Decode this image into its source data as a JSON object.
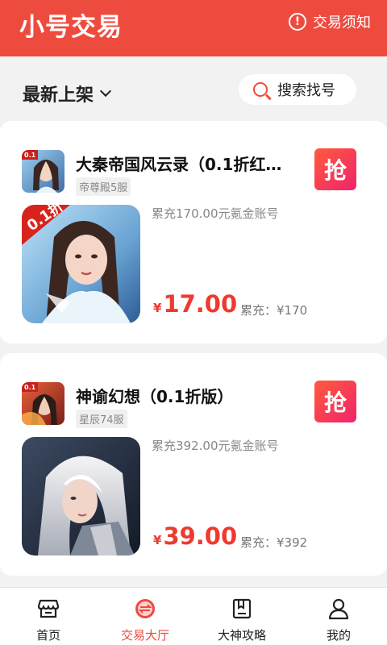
{
  "header": {
    "title": "小号交易",
    "notice_label": "交易须知"
  },
  "toolbar": {
    "sort_label": "最新上架",
    "search_label": "搜索找号"
  },
  "listings": [
    {
      "game_name": "大秦帝国风云录（0.1折红…",
      "server": "帝尊殿5服",
      "grab_label": "抢",
      "description": "累充170.00元氪金账号",
      "currency": "¥",
      "price": "17.00",
      "total_recharge": "累充：¥170",
      "badge_text": "0.1折"
    },
    {
      "game_name": "神谕幻想（0.1折版）",
      "server": "星辰74服",
      "grab_label": "抢",
      "description": "累充392.00元氪金账号",
      "currency": "¥",
      "price": "39.00",
      "total_recharge": "累充：¥392",
      "badge_text": "0.1"
    }
  ],
  "tabbar": {
    "items": [
      {
        "label": "首页",
        "icon": "store-icon"
      },
      {
        "label": "交易大厅",
        "icon": "exchange-icon"
      },
      {
        "label": "大神攻略",
        "icon": "book-icon"
      },
      {
        "label": "我的",
        "icon": "user-icon"
      }
    ],
    "active_index": 1
  },
  "colors": {
    "brand": "#ee4b3f",
    "price": "#ee3a2e",
    "grab_gradient_start": "#ff5a3c",
    "grab_gradient_end": "#f0246c"
  }
}
